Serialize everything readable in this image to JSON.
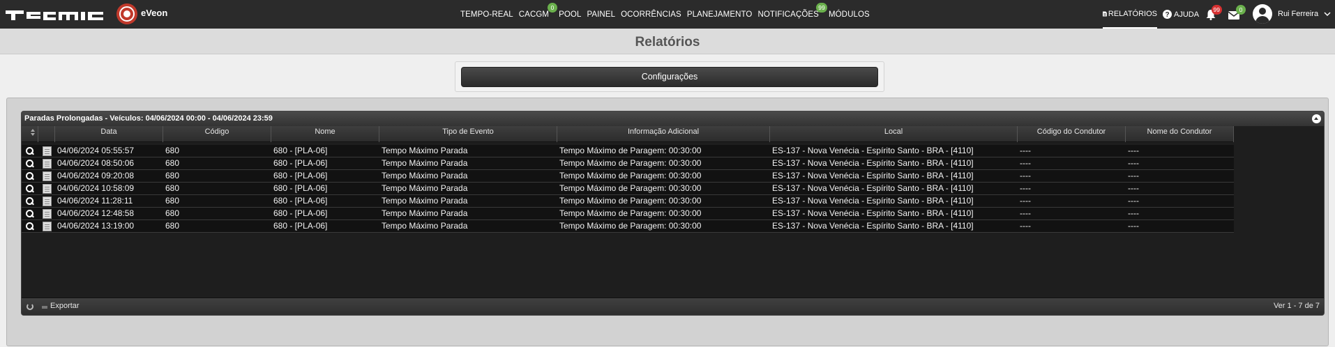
{
  "header": {
    "nav": [
      {
        "label": "TEMPO-REAL",
        "badge": ""
      },
      {
        "label": "CACGM",
        "badge": "0"
      },
      {
        "label": "POOL",
        "badge": ""
      },
      {
        "label": "PAINEL",
        "badge": ""
      },
      {
        "label": "OCORRÊNCIAS",
        "badge": ""
      },
      {
        "label": "PLANEJAMENTO",
        "badge": ""
      },
      {
        "label": "NOTIFICAÇÕES",
        "badge": "99"
      },
      {
        "label": "MÓDULOS",
        "badge": ""
      }
    ],
    "relatorios": "RELATÓRIOS",
    "ajuda": "AJUDA",
    "bell_count": "99",
    "mail_count": "0",
    "user": "Rui Ferreira"
  },
  "page": {
    "title": "Relatórios",
    "config_button": "Configurações"
  },
  "grid": {
    "caption": "Paradas Prolongadas - Veículos: 04/06/2024 00:00 - 04/06/2024 23:59",
    "columns": [
      "Data",
      "Código",
      "Nome",
      "Tipo de Evento",
      "Informação Adicional",
      "Local",
      "Código do Condutor",
      "Nome do Condutor"
    ],
    "rows": [
      [
        "04/06/2024 05:55:57",
        "680",
        "680 - [PLA-06]",
        "Tempo Máximo Parada",
        "Tempo Máximo de Paragem: 00:30:00",
        "ES-137 - Nova Venécia - Espírito Santo - BRA - [4110]",
        "----",
        "----"
      ],
      [
        "04/06/2024 08:50:06",
        "680",
        "680 - [PLA-06]",
        "Tempo Máximo Parada",
        "Tempo Máximo de Paragem: 00:30:00",
        "ES-137 - Nova Venécia - Espírito Santo - BRA - [4110]",
        "----",
        "----"
      ],
      [
        "04/06/2024 09:20:08",
        "680",
        "680 - [PLA-06]",
        "Tempo Máximo Parada",
        "Tempo Máximo de Paragem: 00:30:00",
        "ES-137 - Nova Venécia - Espírito Santo - BRA - [4110]",
        "----",
        "----"
      ],
      [
        "04/06/2024 10:58:09",
        "680",
        "680 - [PLA-06]",
        "Tempo Máximo Parada",
        "Tempo Máximo de Paragem: 00:30:00",
        "ES-137 - Nova Venécia - Espírito Santo - BRA - [4110]",
        "----",
        "----"
      ],
      [
        "04/06/2024 11:28:11",
        "680",
        "680 - [PLA-06]",
        "Tempo Máximo Parada",
        "Tempo Máximo de Paragem: 00:30:00",
        "ES-137 - Nova Venécia - Espírito Santo - BRA - [4110]",
        "----",
        "----"
      ],
      [
        "04/06/2024 12:48:58",
        "680",
        "680 - [PLA-06]",
        "Tempo Máximo Parada",
        "Tempo Máximo de Paragem: 00:30:00",
        "ES-137 - Nova Venécia - Espírito Santo - BRA - [4110]",
        "----",
        "----"
      ],
      [
        "04/06/2024 13:19:00",
        "680",
        "680 - [PLA-06]",
        "Tempo Máximo Parada",
        "Tempo Máximo de Paragem: 00:30:00",
        "ES-137 - Nova Venécia - Espírito Santo - BRA - [4110]",
        "----",
        "----"
      ]
    ],
    "export_label": "Exportar",
    "view_label": "Ver 1 - 7 de 7"
  },
  "colors": {
    "topbar": "#2b2b2b",
    "badge_green": "#6ab04c",
    "badge_red": "#d63031"
  }
}
